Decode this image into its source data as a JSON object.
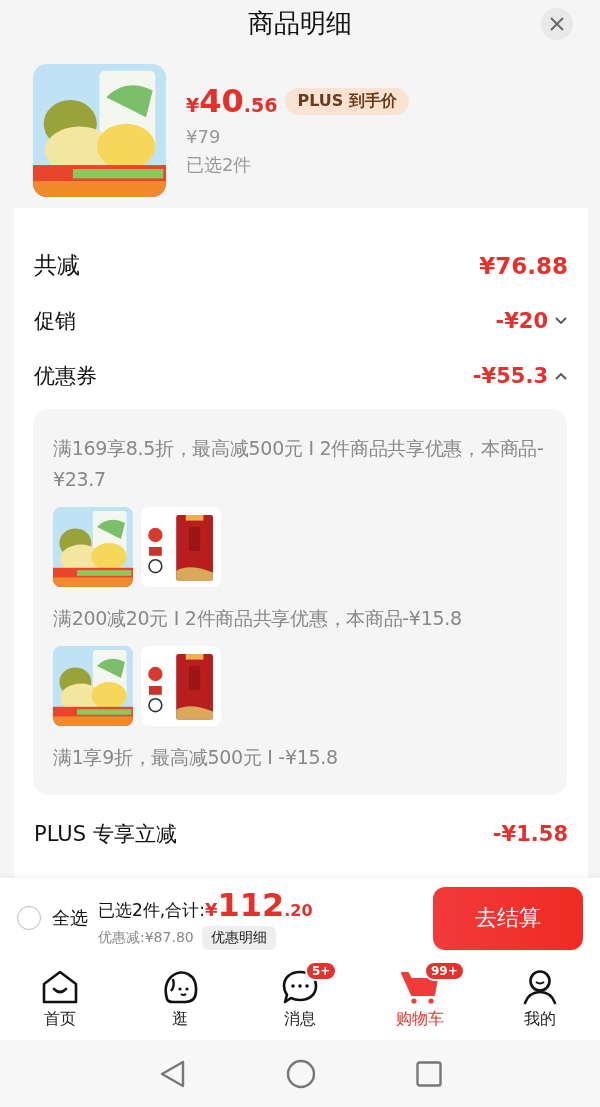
{
  "header": {
    "title": "商品明细"
  },
  "product": {
    "price_currency": "¥",
    "price_integer": "40",
    "price_decimal": ".56",
    "price_tag": "PLUS 到手价",
    "original_price": "¥79",
    "quantity": "已选2件"
  },
  "rows": [
    {
      "kind": "total",
      "label": "共减",
      "value": "¥76.88"
    },
    {
      "kind": "toggle",
      "label": "促销",
      "value": "-¥20",
      "expanded": false
    },
    {
      "kind": "toggle",
      "label": "优惠券",
      "value": "-¥55.3",
      "expanded": true,
      "details": [
        {
          "kind": "text",
          "text": "满169享8.5折，最高减500元 I 2件商品共享优惠，本商品-¥23.7"
        },
        {
          "kind": "pictures"
        },
        {
          "kind": "text",
          "text": "满200减20元 I 2件商品共享优惠，本商品-¥15.8"
        },
        {
          "kind": "pictures"
        },
        {
          "kind": "text",
          "text": "满1享9折，最高减500元 I -¥15.8"
        }
      ]
    },
    {
      "kind": "plain",
      "label": "PLUS 专享立减",
      "value": "-¥1.58"
    }
  ],
  "cart_bar": {
    "select_all": {
      "label": "全选",
      "checked": false
    },
    "summary": "已选2件,合计:",
    "total_currency": "¥",
    "total_integer": "112",
    "total_decimal": ".20",
    "discount": "优惠减:¥87.80",
    "detail_button": "优惠明细",
    "checkout_button": "去结算"
  },
  "tabs": [
    {
      "label": "首页",
      "selected": false
    },
    {
      "label": "逛",
      "selected": false
    },
    {
      "label": "消息",
      "selected": false,
      "badge": "5+"
    },
    {
      "label": "购物车",
      "selected": true,
      "badge": "99+"
    },
    {
      "label": "我的",
      "selected": false
    }
  ]
}
